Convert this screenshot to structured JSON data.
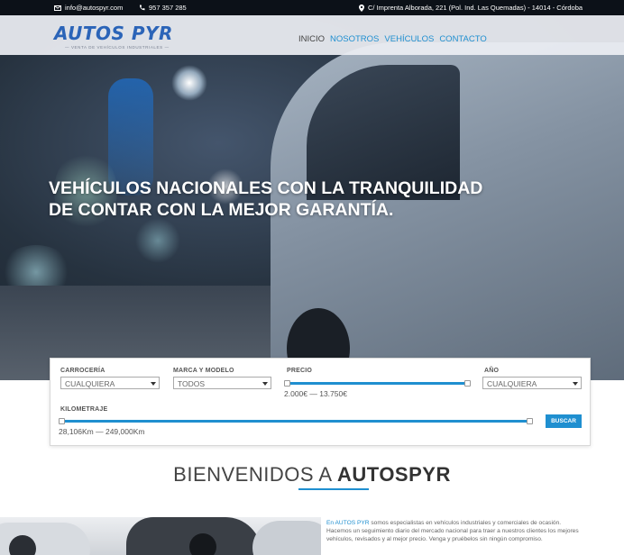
{
  "topbar": {
    "email": "info@autospyr.com",
    "phone": "957 357 285",
    "address": "C/ Imprenta Alborada, 221 (Pol. Ind. Las Quemadas) - 14014 - Córdoba"
  },
  "logo": {
    "name": "AUTOS PYR",
    "tagline": "— VENTA DE VEHÍCULOS INDUSTRIALES —"
  },
  "nav": {
    "items": [
      {
        "label": "INICIO"
      },
      {
        "label": "NOSOTROS"
      },
      {
        "label": "VEHÍCULOS"
      },
      {
        "label": "CONTACTO"
      }
    ]
  },
  "hero": {
    "line1": "VEHÍCULOS NACIONALES CON LA TRANQUILIDAD",
    "line2": "DE CONTAR CON LA MEJOR GARANTÍA."
  },
  "search": {
    "carroceria_label": "CARROCERÍA",
    "carroceria_value": "CUALQUIERA",
    "marca_label": "MARCA Y MODELO",
    "marca_value": "TODOS",
    "precio_label": "PRECIO",
    "precio_range": "2.000€ — 13.750€",
    "anio_label": "AÑO",
    "anio_value": "CUALQUIERA",
    "km_label": "KILOMETRAJE",
    "km_range": "28,106Km — 249,000Km",
    "button": "BUSCAR"
  },
  "welcome": {
    "prefix": "BIENVENIDOS A ",
    "brand": "AUTOSPYR"
  },
  "about": {
    "brand": "En AUTOS PYR",
    "text": " somos especialistas en vehículos industriales y comerciales de ocasión. Hacemos un seguimiento diario del mercado nacional para traer a nuestros clientes los mejores vehículos, revisados y al mejor precio. Venga y pruébelos sin ningún compromiso."
  },
  "colors": {
    "accent": "#1f8fd0",
    "logo": "#2b64b8",
    "topbar": "#0c1118"
  }
}
